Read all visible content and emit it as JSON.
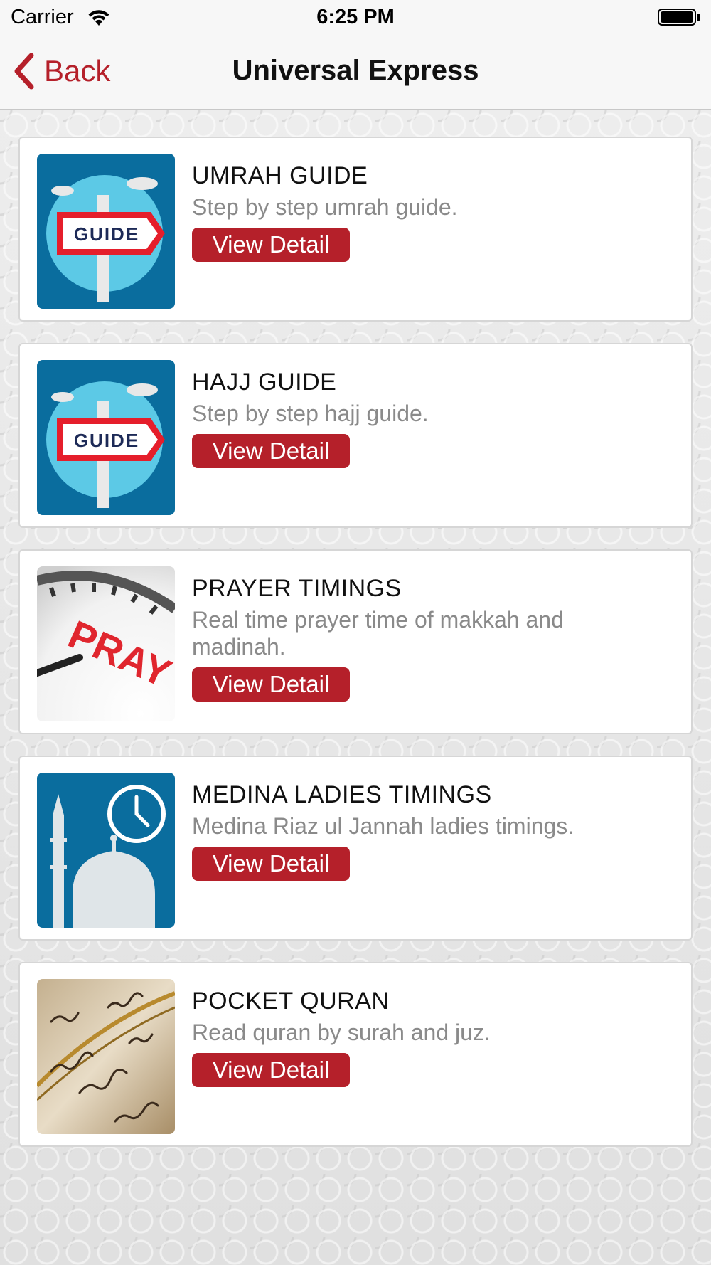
{
  "status_bar": {
    "carrier": "Carrier",
    "time": "6:25 PM"
  },
  "nav": {
    "back_label": "Back",
    "title": "Universal Express"
  },
  "colors": {
    "accent": "#b5202a",
    "guide_bg": "#0a6d9e",
    "guide_circle": "#5cc9e6"
  },
  "cards": [
    {
      "title": "UMRAH GUIDE",
      "description": "Step by step umrah guide.",
      "button": "View Detail",
      "icon": "guide-signpost-icon",
      "sign_text": "GUIDE"
    },
    {
      "title": "HAJJ GUIDE",
      "description": "Step by step hajj guide.",
      "button": "View Detail",
      "icon": "guide-signpost-icon",
      "sign_text": "GUIDE"
    },
    {
      "title": "PRAYER TIMINGS",
      "description": "Real time prayer time of makkah and madinah.",
      "button": "View Detail",
      "icon": "pray-clock-icon",
      "sign_text": "PRAY"
    },
    {
      "title": "MEDINA LADIES TIMINGS",
      "description": "Medina Riaz ul Jannah ladies timings.",
      "button": "View Detail",
      "icon": "mosque-clock-icon"
    },
    {
      "title": "POCKET QURAN",
      "description": "Read quran by surah and juz.",
      "button": "View Detail",
      "icon": "quran-page-icon"
    }
  ]
}
